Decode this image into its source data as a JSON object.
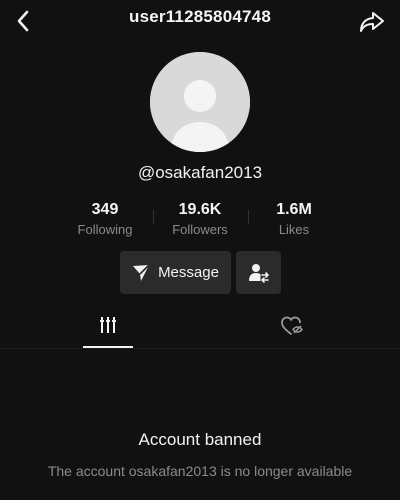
{
  "header": {
    "username": "user11285804748",
    "back_icon": "chevron-left-icon",
    "share_icon": "share-arrow-icon"
  },
  "profile": {
    "handle": "@osakafan2013",
    "avatar_icon": "default-avatar-icon"
  },
  "stats": [
    {
      "value": "349",
      "label": "Following"
    },
    {
      "value": "19.6K",
      "label": "Followers"
    },
    {
      "value": "1.6M",
      "label": "Likes"
    }
  ],
  "actions": {
    "message_label": "Message",
    "message_icon": "send-icon",
    "follow_icon": "user-swap-icon"
  },
  "tabs": [
    {
      "icon": "videos-grid-icon",
      "active": true
    },
    {
      "icon": "liked-hidden-icon",
      "active": false
    }
  ],
  "notice": {
    "title": "Account banned",
    "description": "The account osakafan2013 is no longer available"
  },
  "colors": {
    "background": "#111111",
    "button_bg": "#2b2b2b",
    "text_primary": "#f2f2f2",
    "text_secondary": "#8b8b8b"
  }
}
